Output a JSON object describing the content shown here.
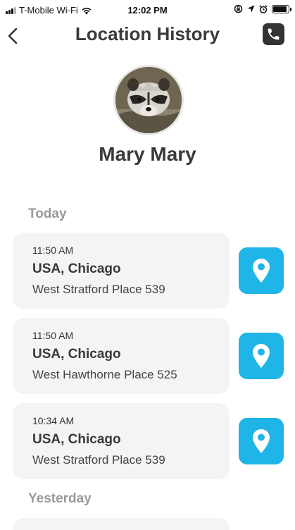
{
  "status_bar": {
    "carrier": "T-Mobile Wi-Fi",
    "time": "12:02 PM"
  },
  "header": {
    "title": "Location History"
  },
  "profile": {
    "name": "Mary Mary"
  },
  "sections": [
    {
      "label": "Today",
      "items": [
        {
          "time": "11:50 AM",
          "city": "USA, Chicago",
          "street": "West Stratford Place 539"
        },
        {
          "time": "11:50 AM",
          "city": "USA, Chicago",
          "street": "West Hawthorne Place 525"
        },
        {
          "time": "10:34 AM",
          "city": "USA, Chicago",
          "street": "West Stratford Place 539"
        }
      ]
    },
    {
      "label": "Yesterday",
      "items": []
    }
  ],
  "colors": {
    "accent": "#1fb5e6",
    "card_bg": "#f4f4f4",
    "section_label": "#9a9a9a"
  },
  "icons": [
    "back-chevron-icon",
    "phone-icon",
    "location-pin-icon",
    "wifi-icon",
    "battery-icon"
  ]
}
